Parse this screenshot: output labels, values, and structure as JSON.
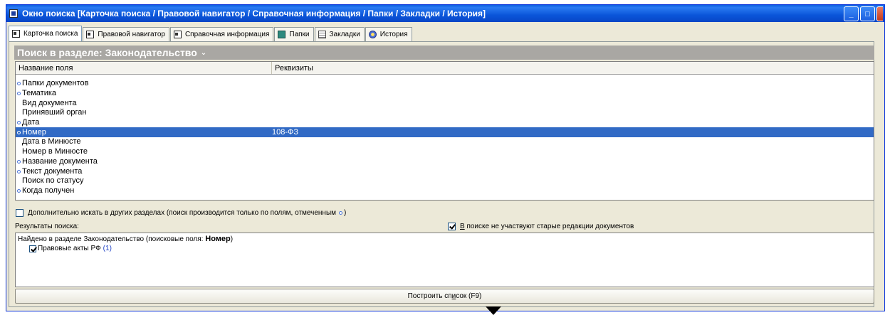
{
  "window": {
    "title": "Окно поиска [Карточка поиска / Правовой навигатор / Справочная информация / Папки / Закладки / История]",
    "controls": [
      "_",
      "□",
      ""
    ]
  },
  "tabs": [
    {
      "label": "Карточка поиска",
      "icon": "search-card-icon",
      "active": true
    },
    {
      "label": "Правовой навигатор",
      "icon": "legal-navigator-icon",
      "active": false
    },
    {
      "label": "Справочная информация",
      "icon": "reference-info-icon",
      "active": false
    },
    {
      "label": "Папки",
      "icon": "folder-icon",
      "active": false
    },
    {
      "label": "Закладки",
      "icon": "bookmark-icon",
      "active": false
    },
    {
      "label": "История",
      "icon": "history-icon",
      "active": false
    }
  ],
  "section": {
    "title": "Поиск в разделе: Законодательство",
    "chevron": "⌄"
  },
  "grid": {
    "columns": [
      "Название поля",
      "Реквизиты"
    ],
    "rows": [
      {
        "name": "Папки документов",
        "value": "",
        "marked": true,
        "selected": false
      },
      {
        "name": "Тематика",
        "value": "",
        "marked": true,
        "selected": false
      },
      {
        "name": "Вид документа",
        "value": "",
        "marked": false,
        "selected": false
      },
      {
        "name": "Принявший орган",
        "value": "",
        "marked": false,
        "selected": false
      },
      {
        "name": "Дата",
        "value": "",
        "marked": true,
        "selected": false
      },
      {
        "name": "Номер",
        "value": "108-ФЗ",
        "marked": true,
        "selected": true
      },
      {
        "name": "Дата в Минюсте",
        "value": "",
        "marked": false,
        "selected": false
      },
      {
        "name": "Номер в Минюсте",
        "value": "",
        "marked": false,
        "selected": false
      },
      {
        "name": "Название документа",
        "value": "",
        "marked": true,
        "selected": false
      },
      {
        "name": "Текст документа",
        "value": "",
        "marked": true,
        "selected": false
      },
      {
        "name": "Поиск по статусу",
        "value": "",
        "marked": false,
        "selected": false
      },
      {
        "name": "Когда получен",
        "value": "",
        "marked": true,
        "selected": false
      }
    ]
  },
  "extra_search": {
    "checked": false,
    "label": "Дополнительно искать в других разделах (поиск производится только по полям, отмеченным",
    "suffix": ")"
  },
  "results": {
    "label": "Результаты поиска:",
    "old_editions": {
      "checked": true,
      "underlined": "В",
      "rest": " поиске не участвуют старые редакции документов"
    },
    "found_text": "Найдено в разделе Законодательство (поисковые поля:",
    "found_field": "Номер",
    "found_close": ")",
    "item_label": "Правовые акты РФ",
    "item_count": "(1)",
    "item_checked": true
  },
  "build_button": {
    "before": "Построить сп",
    "underlined": "и",
    "after": "сок (F9)"
  },
  "colors": {
    "titlebar": "#0a55d9",
    "selection": "#316ac5",
    "section_header": "#a9a7a3",
    "marker": "#4a74d8",
    "count": "#1b3fc5"
  }
}
